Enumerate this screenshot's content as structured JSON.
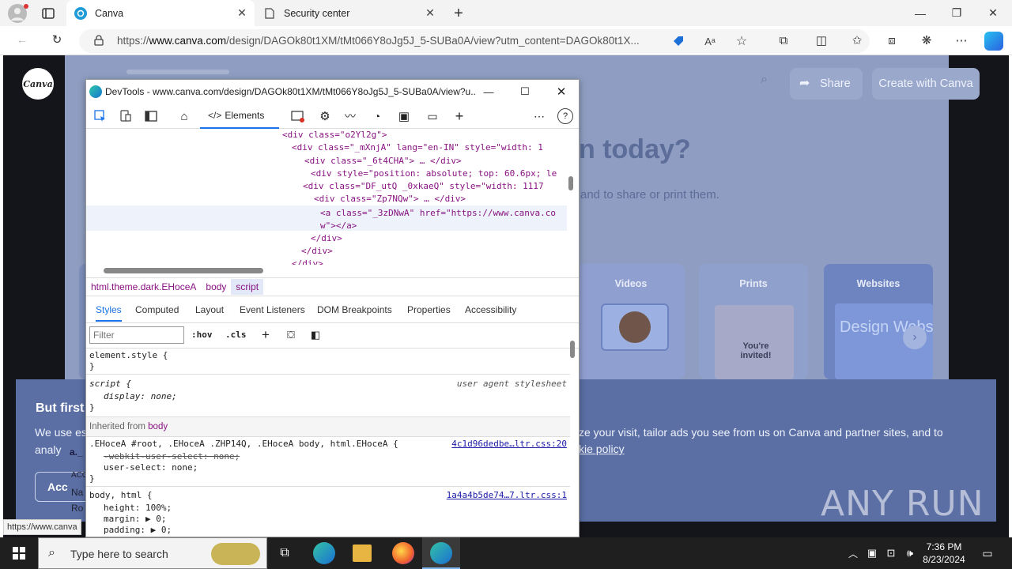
{
  "browser": {
    "tabs": [
      {
        "title": "Canva"
      },
      {
        "title": "Security center"
      }
    ],
    "url_prefix": "https://",
    "url_domain": "www.canva.com",
    "url_rest": "/design/DAGOk80t1XM/tMt066Y8oJg5J_5-SUBa0A/view?utm_content=DAGOk80t1X...",
    "new_tab": "+"
  },
  "canva": {
    "logo": "Canva",
    "share": "Share",
    "create": "Create with Canva",
    "headline": "n today?",
    "sub": "and to share or print them.",
    "cards": [
      {
        "label": "Videos"
      },
      {
        "label": "Prints",
        "invite": "You're invited!"
      },
      {
        "label": "Websites",
        "big": "Design Websit"
      }
    ],
    "cookie_title": "But first",
    "cookie_text_left": "We use es",
    "cookie_text_left2": "analy",
    "cookie_text_right": "ze your visit, tailor ads you see from us on Canva and partner sites, and to",
    "cookie_link": "kie policy",
    "btn_left": "Acc",
    "hint_a": "a._",
    "hint_acc": "ACC",
    "hint_na": "Na",
    "hint_ro": "Ro",
    "status_url": "https://www.canva"
  },
  "watermark": "ANY RUN",
  "devtools": {
    "title": "DevTools - www.canva.com/design/DAGOk80t1XM/tMt066Y8oJg5J_5-SUBa0A/view?u...",
    "elements_tab": "Elements",
    "dom": [
      {
        "l": "<div class=\"o2Yl2g\">",
        "i": 252
      },
      {
        "l": "<div class=\"_mXnjA\" lang=\"en-IN\" style=\"width: 1",
        "i": 264
      },
      {
        "l": "<div class=\"_6t4CHA\"> … </div>",
        "i": 276
      },
      {
        "l": "<div style=\"position: absolute; top: 60.6px; le",
        "i": 284
      },
      {
        "l": "<div class=\"DF_utQ _0xkaeQ\" style=\"width: 1117",
        "i": 276
      },
      {
        "l": "<div class=\"Zp7NQw\"> … </div>",
        "i": 288
      },
      {
        "l": "<a class=\"_3zDNwA\" href=\"https://www.canva.co",
        "i": 296
      },
      {
        "l": "w\"></a>",
        "i": 296
      },
      {
        "l": "</div>",
        "i": 284
      },
      {
        "l": "</div>",
        "i": 272
      },
      {
        "l": "</div>",
        "i": 260
      }
    ],
    "breadcrumbs": [
      "html.theme.dark.EHoceA",
      "body",
      "script"
    ],
    "subtabs": [
      "Styles",
      "Computed",
      "Layout",
      "Event Listeners",
      "DOM Breakpoints",
      "Properties",
      "Accessibility"
    ],
    "filter_placeholder": "Filter",
    "hov": ":hov",
    "cls": ".cls",
    "element_style": "element.style {",
    "close_brace": "}",
    "script_sel": "script {",
    "ua": "user agent stylesheet",
    "display_decl": "display: none;",
    "inherited": "Inherited from",
    "inherited_from": "body",
    "rule3_sel": ".EHoceA #root, .EHoceA .ZHP14Q, .EHoceA body, html.EHoceA {",
    "rule3_src": "4c1d96dedbe…ltr.css:20",
    "rule3_d1": "-webkit-user-select: none;",
    "rule3_d2": "user-select: none;",
    "rule4_sel": "body, html {",
    "rule4_src": "1a4a4b5de74…7.ltr.css:1",
    "rule4_d1": "height: 100%;",
    "rule4_d2": "margin: ▶ 0;",
    "rule4_d3": "padding: ▶ 0;"
  },
  "taskbar": {
    "search": "Type here to search",
    "time": "7:36 PM",
    "date": "8/23/2024"
  }
}
